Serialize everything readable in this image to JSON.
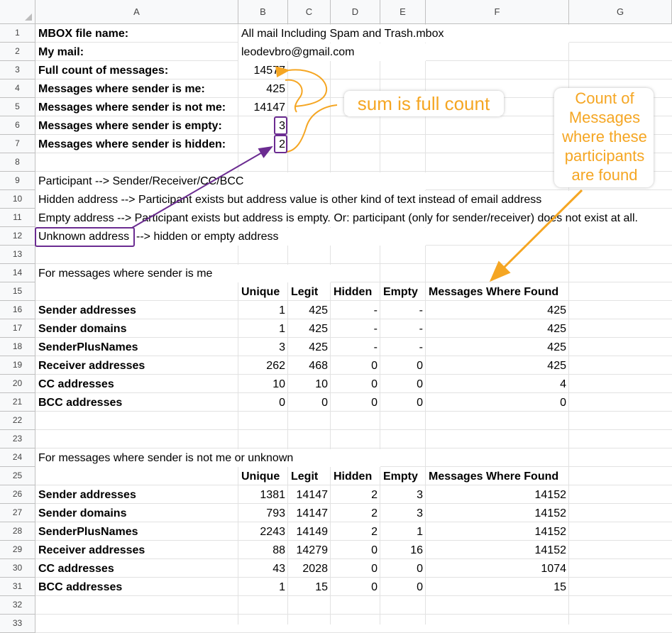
{
  "columns": [
    "A",
    "B",
    "C",
    "D",
    "E",
    "F",
    "G"
  ],
  "rows": [
    "1",
    "2",
    "3",
    "4",
    "5",
    "6",
    "7",
    "8",
    "9",
    "10",
    "11",
    "12",
    "13",
    "14",
    "15",
    "16",
    "17",
    "18",
    "19",
    "20",
    "21",
    "22",
    "23",
    "24",
    "25",
    "26",
    "27",
    "28",
    "29",
    "30",
    "31",
    "32",
    "33"
  ],
  "info": {
    "mbox_label": "MBOX file name:",
    "mbox_value": "All mail Including Spam and Trash.mbox",
    "mail_label": "My mail:",
    "mail_value": "leodevbro@gmail.com",
    "full_label": "Full count of messages:",
    "full_value": "14577",
    "me_label": "Messages where sender is me:",
    "me_value": "425",
    "notme_label": "Messages where sender is not me:",
    "notme_value": "14147",
    "empty_label": "Messages where sender is empty:",
    "empty_value": "3",
    "hidden_label": "Messages where sender is hidden:",
    "hidden_value": "2"
  },
  "notes": {
    "n9": "Participant --> Sender/Receiver/CC/BCC",
    "n10": "Hidden address --> Participant exists but address value is other kind of text instead of email address",
    "n11": "Empty address --> Participant exists but address is empty. Or: participant (only for sender/receiver) does not exist at all.",
    "n12_unknown": "Unknown address",
    "n12_rest": "--> hidden or empty address"
  },
  "table_headers": [
    "Unique",
    "Legit",
    "Hidden",
    "Empty",
    "Messages Where Found"
  ],
  "section_me": {
    "title": "For messages where sender is me",
    "rows": [
      {
        "label": "Sender addresses",
        "values": [
          "1",
          "425",
          "-",
          "-",
          "425"
        ]
      },
      {
        "label": "Sender domains",
        "values": [
          "1",
          "425",
          "-",
          "-",
          "425"
        ]
      },
      {
        "label": "SenderPlusNames",
        "values": [
          "3",
          "425",
          "-",
          "-",
          "425"
        ]
      },
      {
        "label": "Receiver addresses",
        "values": [
          "262",
          "468",
          "0",
          "0",
          "425"
        ]
      },
      {
        "label": "CC addresses",
        "values": [
          "10",
          "10",
          "0",
          "0",
          "4"
        ]
      },
      {
        "label": "BCC addresses",
        "values": [
          "0",
          "0",
          "0",
          "0",
          "0"
        ]
      }
    ]
  },
  "section_notme": {
    "title": "For messages where sender is not me or unknown",
    "rows": [
      {
        "label": "Sender addresses",
        "values": [
          "1381",
          "14147",
          "2",
          "3",
          "14152"
        ]
      },
      {
        "label": "Sender domains",
        "values": [
          "793",
          "14147",
          "2",
          "3",
          "14152"
        ]
      },
      {
        "label": "SenderPlusNames",
        "values": [
          "2243",
          "14149",
          "2",
          "1",
          "14152"
        ]
      },
      {
        "label": "Receiver addresses",
        "values": [
          "88",
          "14279",
          "0",
          "16",
          "14152"
        ]
      },
      {
        "label": "CC addresses",
        "values": [
          "43",
          "2028",
          "0",
          "0",
          "1074"
        ]
      },
      {
        "label": "BCC addresses",
        "values": [
          "1",
          "15",
          "0",
          "0",
          "15"
        ]
      }
    ]
  },
  "annotations": {
    "sum_text": "sum is full count",
    "count_lines": [
      "Count of",
      "Messages",
      "where these",
      "participants",
      "are found"
    ]
  },
  "colors": {
    "annotation_orange": "#f5a623",
    "annotation_purple": "#6b2c91",
    "header_bg": "#f8f9fa",
    "grid_line": "#e2e2e2"
  }
}
